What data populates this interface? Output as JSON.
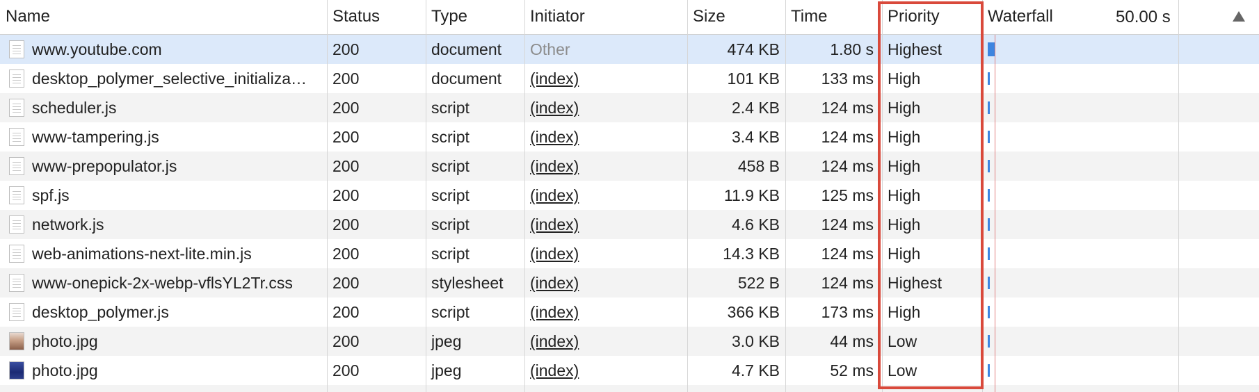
{
  "columns": {
    "name": "Name",
    "status": "Status",
    "type": "Type",
    "initiator": "Initiator",
    "size": "Size",
    "time": "Time",
    "priority": "Priority",
    "waterfall": "Waterfall",
    "waterfall_time": "50.00 s"
  },
  "rows": [
    {
      "name": "www.youtube.com",
      "status": "200",
      "type": "document",
      "initiator": "Other",
      "size": "474 KB",
      "time": "1.80 s",
      "priority": "Highest",
      "icon": "document-icon"
    },
    {
      "name": "desktop_polymer_selective_initializa…",
      "status": "200",
      "type": "document",
      "initiator": "(index)",
      "size": "101 KB",
      "time": "133 ms",
      "priority": "High",
      "icon": "document-icon"
    },
    {
      "name": "scheduler.js",
      "status": "200",
      "type": "script",
      "initiator": "(index)",
      "size": "2.4 KB",
      "time": "124 ms",
      "priority": "High",
      "icon": "document-icon"
    },
    {
      "name": "www-tampering.js",
      "status": "200",
      "type": "script",
      "initiator": "(index)",
      "size": "3.4 KB",
      "time": "124 ms",
      "priority": "High",
      "icon": "document-icon"
    },
    {
      "name": "www-prepopulator.js",
      "status": "200",
      "type": "script",
      "initiator": "(index)",
      "size": "458 B",
      "time": "124 ms",
      "priority": "High",
      "icon": "document-icon"
    },
    {
      "name": "spf.js",
      "status": "200",
      "type": "script",
      "initiator": "(index)",
      "size": "11.9 KB",
      "time": "125 ms",
      "priority": "High",
      "icon": "document-icon"
    },
    {
      "name": "network.js",
      "status": "200",
      "type": "script",
      "initiator": "(index)",
      "size": "4.6 KB",
      "time": "124 ms",
      "priority": "High",
      "icon": "document-icon"
    },
    {
      "name": "web-animations-next-lite.min.js",
      "status": "200",
      "type": "script",
      "initiator": "(index)",
      "size": "14.3 KB",
      "time": "124 ms",
      "priority": "High",
      "icon": "document-icon"
    },
    {
      "name": "www-onepick-2x-webp-vflsYL2Tr.css",
      "status": "200",
      "type": "stylesheet",
      "initiator": "(index)",
      "size": "522 B",
      "time": "124 ms",
      "priority": "Highest",
      "icon": "document-icon"
    },
    {
      "name": "desktop_polymer.js",
      "status": "200",
      "type": "script",
      "initiator": "(index)",
      "size": "366 KB",
      "time": "173 ms",
      "priority": "High",
      "icon": "document-icon"
    },
    {
      "name": "photo.jpg",
      "status": "200",
      "type": "jpeg",
      "initiator": "(index)",
      "size": "3.0 KB",
      "time": "44 ms",
      "priority": "Low",
      "icon": "photo-thumbnail-icon"
    },
    {
      "name": "photo.jpg",
      "status": "200",
      "type": "jpeg",
      "initiator": "(index)",
      "size": "4.7 KB",
      "time": "52 ms",
      "priority": "Low",
      "icon": "image-thumbnail-icon"
    }
  ],
  "colors": {
    "selected_row": "#dce9fa",
    "highlight_box": "#d9493b",
    "waterfall_bar": "#3d85e0"
  }
}
